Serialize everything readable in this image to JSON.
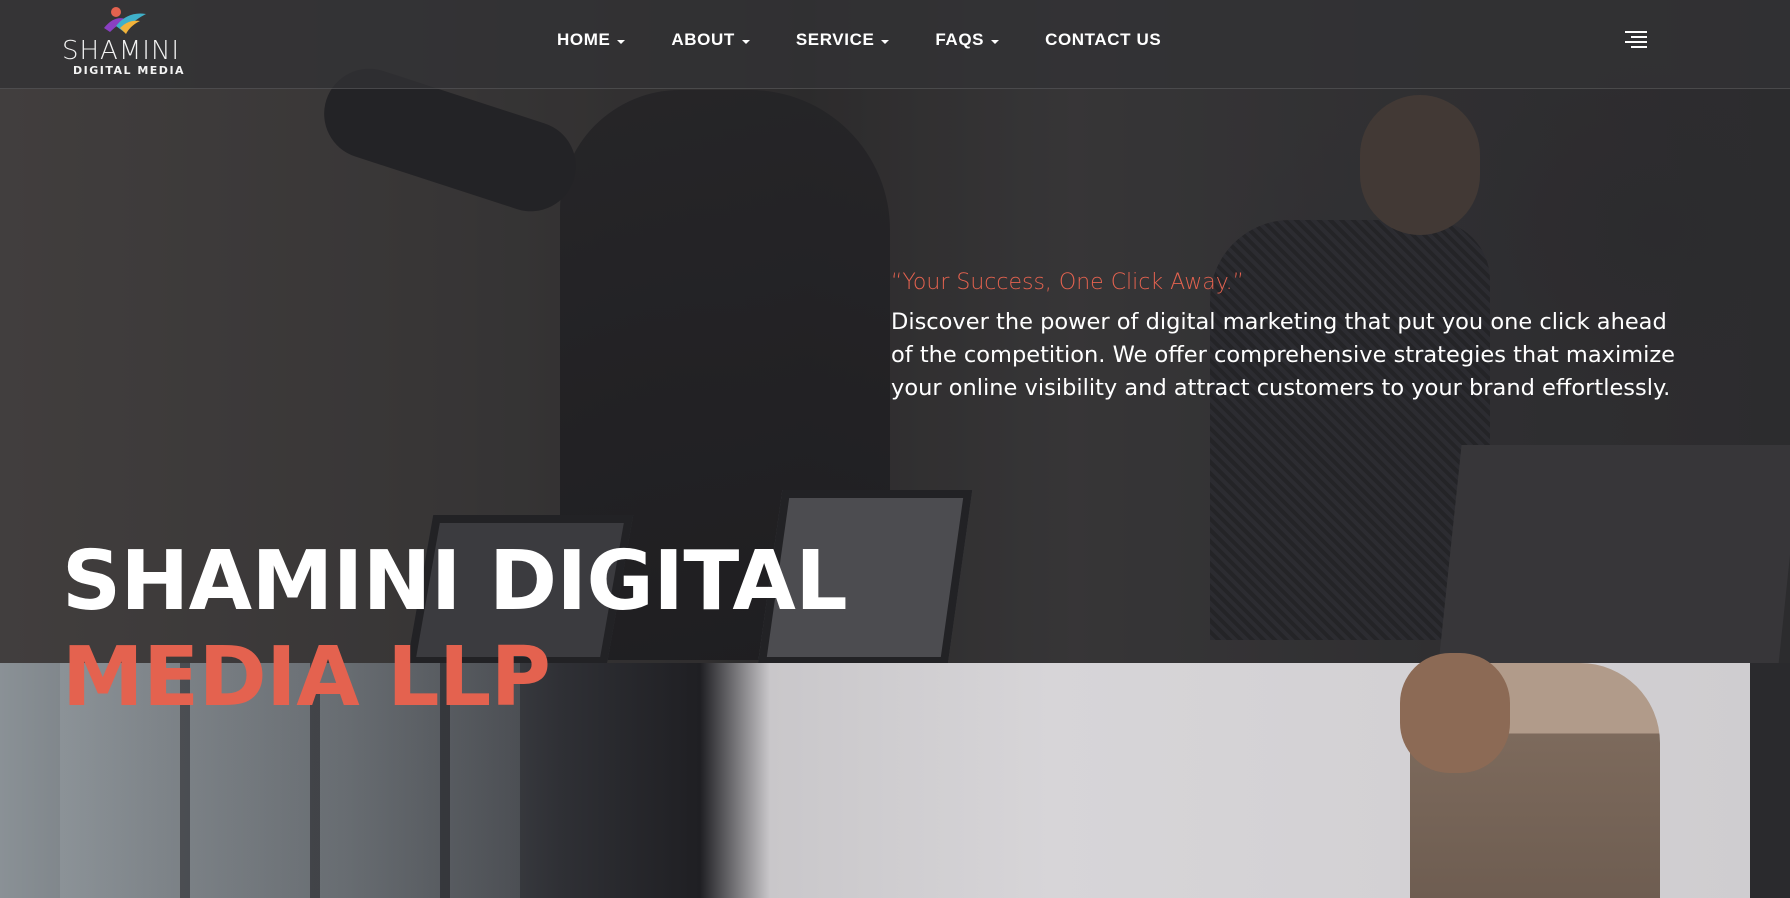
{
  "brand": {
    "logo_word": "SHAMINI",
    "logo_sub": "DIGITAL MEDIA",
    "accent_color": "#e4624f"
  },
  "nav": {
    "items": [
      {
        "label": "HOME",
        "has_dropdown": true
      },
      {
        "label": "ABOUT",
        "has_dropdown": true
      },
      {
        "label": "SERVICE",
        "has_dropdown": true
      },
      {
        "label": "FAQS",
        "has_dropdown": true
      },
      {
        "label": "CONTACT US",
        "has_dropdown": false
      }
    ],
    "menu_icon": "hamburger-menu-icon"
  },
  "hero": {
    "tagline": "“Your Success, One Click Away.”",
    "description": "Discover the power of digital marketing that put you one click ahead of the competition. We offer comprehensive strategies that maximize your online visibility and attract customers to your brand effortlessly.",
    "title_line1": "SHAMINI DIGITAL",
    "title_line2": "MEDIA LLP"
  }
}
